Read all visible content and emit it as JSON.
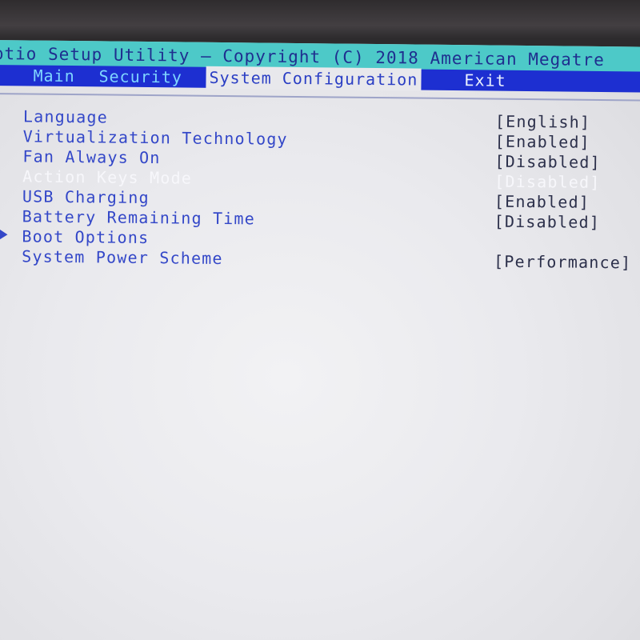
{
  "title_bar": {
    "text": "ptio Setup Utility – Copyright (C) 2018 American Megatre"
  },
  "menu": {
    "tabs": [
      {
        "label": "Main"
      },
      {
        "label": "Security"
      },
      {
        "label": "System Configuration"
      },
      {
        "label": "Exit"
      }
    ],
    "active_tab": "System Configuration"
  },
  "settings": [
    {
      "label": "Language",
      "value": "[English]"
    },
    {
      "label": "Virtualization Technology",
      "value": "[Enabled]"
    },
    {
      "label": "Fan Always On",
      "value": "[Disabled]"
    },
    {
      "label": "Action Keys Mode",
      "value": "[Disabled]",
      "selected": true
    },
    {
      "label": "USB Charging",
      "value": "[Enabled]"
    },
    {
      "label": "Battery Remaining Time",
      "value": "[Disabled]"
    },
    {
      "label": "Boot Options",
      "value": "",
      "submenu": true
    },
    {
      "label": "System Power Scheme",
      "value": "[Performance]"
    }
  ],
  "colors": {
    "title_bar_bg": "#4dc9c8",
    "menu_bar_bg": "#1d2fd1",
    "label_text": "#3347c8",
    "value_text": "#2b2f4a",
    "selected_text": "#f7f7fb"
  }
}
